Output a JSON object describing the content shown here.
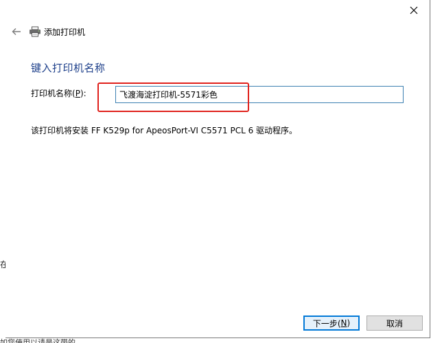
{
  "window": {
    "title": "添加打印机",
    "close_icon": "close-icon"
  },
  "nav": {
    "back_icon": "back-arrow-icon",
    "printer_icon": "printer-icon",
    "title": "添加打印机"
  },
  "main": {
    "heading": "键入打印机名称",
    "name_label_prefix": "打印机名称(",
    "name_label_key": "P",
    "name_label_suffix": "):",
    "name_value": "飞渡海淀打印机-5571彩色",
    "driver_info": "该打印机将安装 FF K529p for ApeosPort-VI C5571 PCL 6 驱动程序。",
    "highlight_color": "#e0201b"
  },
  "buttons": {
    "next_prefix": "下一步(",
    "next_key": "N",
    "next_suffix": ")",
    "cancel": "取消"
  },
  "background": {
    "side_glyph": "在",
    "bottom_text": "如您使用以请是这带的"
  }
}
